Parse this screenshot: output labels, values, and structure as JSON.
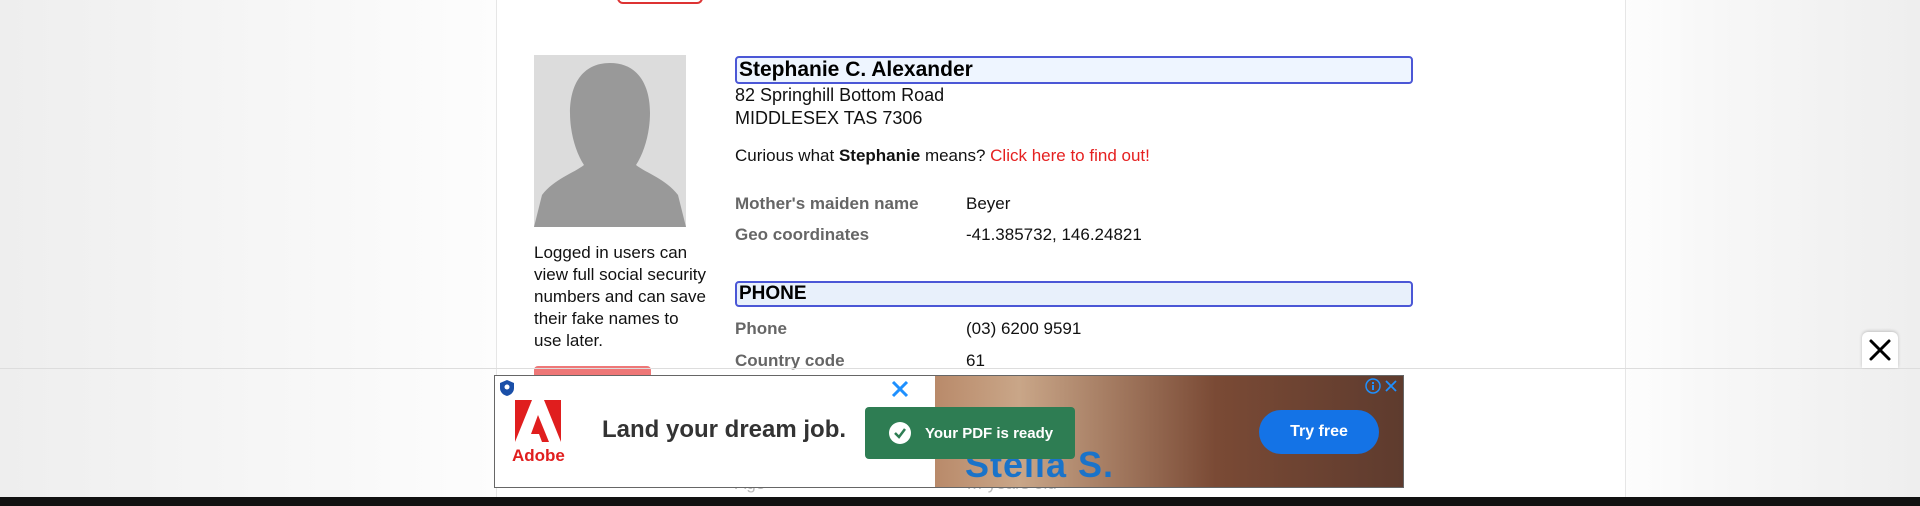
{
  "person": {
    "name": "Stephanie C. Alexander",
    "address_line1": "82 Springhill Bottom Road",
    "address_line2": "MIDDLESEX TAS 7306"
  },
  "sidebar": {
    "login_note": "Logged in users can view full social security numbers and can save their fake names to use later."
  },
  "curious": {
    "prefix": "Curious what",
    "first_name": "Stephanie",
    "suffix": "means?",
    "link": "Click here to find out!"
  },
  "details": [
    {
      "label": "Mother's maiden name",
      "value": "Beyer"
    },
    {
      "label": "Geo coordinates",
      "value": "-41.385732, 146.24821"
    }
  ],
  "phone_section": {
    "title": "PHONE",
    "rows": [
      {
        "label": "Phone",
        "value": "(03) 6200 9591"
      },
      {
        "label": "Country code",
        "value": "61"
      }
    ]
  },
  "partial": {
    "label": "Age",
    "value": "… years old"
  },
  "ad": {
    "brand": "Adobe",
    "headline": "Land your dream job.",
    "toast": "Your PDF is ready",
    "overlay_name": "Stella S.",
    "cta": "Try free"
  },
  "colors": {
    "link_red": "#e52020",
    "header_border": "#4b57d6",
    "adobe_red": "#e01e1e",
    "cta_blue": "#1473e6",
    "toast_green": "#2e7d53"
  }
}
